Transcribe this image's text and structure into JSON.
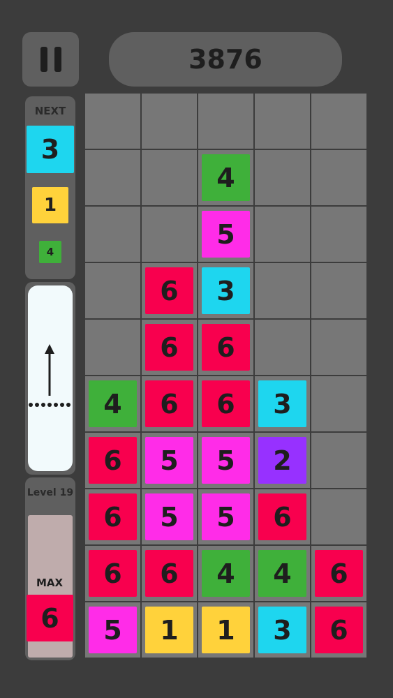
{
  "score": "3876",
  "next": {
    "label": "NEXT",
    "tiles": [
      {
        "value": "3",
        "color": "#1ed6ef"
      },
      {
        "value": "1",
        "color": "#ffd23b"
      },
      {
        "value": "4",
        "color": "#3fb03a"
      }
    ]
  },
  "level": {
    "label": "Level 19",
    "max_label": "MAX",
    "max_tile": {
      "value": "6",
      "color": "#f8004e"
    }
  },
  "colors": {
    "background": "#3c3c3c",
    "panel": "#5f5f5f",
    "empty_cell": "#777777",
    "tile_1": "#ffd23b",
    "tile_2": "#9731ff",
    "tile_3": "#1ed6ef",
    "tile_4": "#3fb03a",
    "tile_5": "#ff2ce8",
    "tile_6": "#f8004e"
  },
  "icons": {
    "pause": "pause-icon",
    "launch": "up-arrow-icon"
  },
  "board": {
    "columns": 5,
    "rows": 10,
    "grid": [
      [
        "",
        "",
        "",
        "",
        ""
      ],
      [
        "",
        "",
        "4",
        "",
        ""
      ],
      [
        "",
        "",
        "5",
        "",
        ""
      ],
      [
        "",
        "6",
        "3",
        "",
        ""
      ],
      [
        "",
        "6",
        "6",
        "",
        ""
      ],
      [
        "4",
        "6",
        "6",
        "3",
        ""
      ],
      [
        "6",
        "5",
        "5",
        "2",
        ""
      ],
      [
        "6",
        "5",
        "5",
        "6",
        ""
      ],
      [
        "6",
        "6",
        "4",
        "4",
        "6"
      ],
      [
        "5",
        "1",
        "1",
        "3",
        "6"
      ]
    ]
  }
}
